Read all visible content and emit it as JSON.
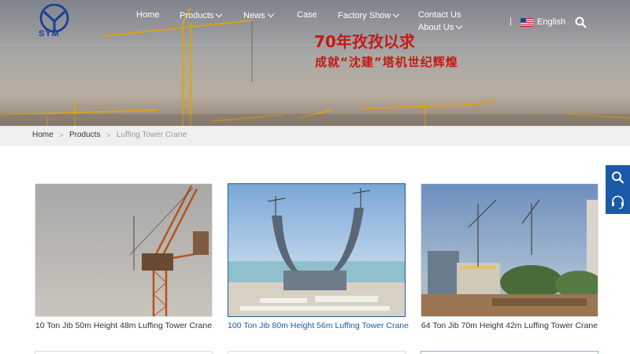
{
  "header": {
    "logo_text": "SYM",
    "nav": [
      {
        "label": "Home",
        "has_dropdown": false
      },
      {
        "label": "Products",
        "has_dropdown": true
      },
      {
        "label": "News",
        "has_dropdown": true
      },
      {
        "label": "Case",
        "has_dropdown": false
      },
      {
        "label": "Factory Show",
        "has_dropdown": true
      },
      {
        "label": "Contact Us",
        "has_dropdown": false
      },
      {
        "label": "About Us",
        "has_dropdown": true
      }
    ],
    "language": "English",
    "search_icon": "search-icon"
  },
  "banner": {
    "slogan_line1": "70年孜孜以求",
    "slogan_line2": "成就“沈建”塔机世纪辉煌"
  },
  "breadcrumb": {
    "items": [
      "Home",
      "Products",
      "Luffing Tower Crane"
    ],
    "separator": ">"
  },
  "products": [
    {
      "title": "10 Ton Jib 50m Height 48m Luffing Tower Crane",
      "highlighted": false
    },
    {
      "title": "100 Ton Jib 80m Height 56m Luffing Tower Crane",
      "highlighted": true
    },
    {
      "title": "64 Ton Jib 70m Height 42m Luffing Tower Crane",
      "highlighted": false
    }
  ],
  "side_tools": [
    "search-icon",
    "headset-icon"
  ],
  "colors": {
    "brand_blue": "#1b5aa8",
    "slogan_red": "#c41a12",
    "link_active": "#1f5c9e",
    "breadcrumb_bg": "#efefef"
  }
}
